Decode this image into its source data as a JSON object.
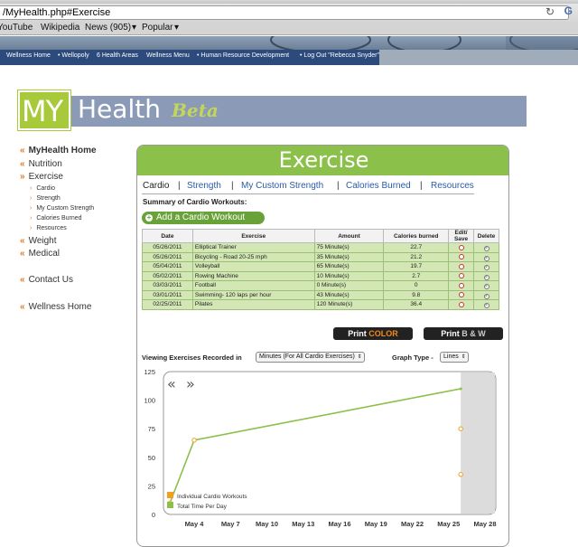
{
  "browser": {
    "url": "/MyHealth.php#Exercise",
    "bookmarks": [
      "YouTube",
      "Wikipedia",
      "News (905)",
      "Popular"
    ]
  },
  "nav": [
    "Wellness Home",
    "Wellopoly",
    "6 Health Areas",
    "Wellness Menu",
    "Human Resource Development",
    "Log Out \"Rebecca Snyder\""
  ],
  "logo": {
    "my": "MY",
    "health": "Health",
    "beta": "Beta"
  },
  "sidebar": {
    "main": [
      {
        "label": "MyHealth Home"
      },
      {
        "label": "Nutrition"
      },
      {
        "label": "Exercise"
      }
    ],
    "exercise_sub": [
      "Cardio",
      "Strength",
      "My Custom Strength",
      "Calories Burned",
      "Resources"
    ],
    "more": [
      {
        "label": "Weight"
      },
      {
        "label": "Medical"
      }
    ],
    "contact": "Contact Us",
    "wellness": "Wellness Home"
  },
  "panel": {
    "title": "Exercise",
    "tabs": [
      "Cardio",
      "Strength",
      "My Custom Strength",
      "Calories Burned",
      "Resources"
    ],
    "summary_title": "Summary of Cardio Workouts:",
    "add_button": "Add a Cardio Workout",
    "table": {
      "headers": [
        "Date",
        "Exercise",
        "Amount",
        "Calories burned",
        "Edit/ Save",
        "Delete"
      ],
      "rows": [
        {
          "date": "05/26/2011",
          "exercise": "Elliptical Trainer",
          "amount": "75 Minute(s)",
          "calories": "22.7"
        },
        {
          "date": "05/26/2011",
          "exercise": "Bicycling - Road 20-25 mph",
          "amount": "35 Minute(s)",
          "calories": "21.2"
        },
        {
          "date": "05/04/2011",
          "exercise": "Volleyball",
          "amount": "65 Minute(s)",
          "calories": "19.7"
        },
        {
          "date": "05/02/2011",
          "exercise": "Rowing Machine",
          "amount": "10 Minute(s)",
          "calories": "2.7"
        },
        {
          "date": "03/03/2011",
          "exercise": "Football",
          "amount": "0 Minute(s)",
          "calories": "0"
        },
        {
          "date": "03/01/2011",
          "exercise": "Swimming- 120 laps per hour",
          "amount": "43 Minute(s)",
          "calories": "9.8"
        },
        {
          "date": "02/25/2011",
          "exercise": "Pilates",
          "amount": "120 Minute(s)",
          "calories": "36.4"
        }
      ]
    },
    "print_color": {
      "prefix": "Print ",
      "accent": "COLOR"
    },
    "print_bw": {
      "prefix": "Print ",
      "accent": "B & W"
    },
    "view_label": "Viewing Exercises Recorded in",
    "view_select": "Minutes (For All Cardio Exercises)",
    "graph_type_label": "Graph Type -",
    "graph_type_select": "Lines"
  },
  "chart_data": {
    "type": "line",
    "nav_prev": "«",
    "nav_next": "»",
    "yticks": [
      0,
      25,
      50,
      75,
      100,
      125
    ],
    "ylim": [
      0,
      125
    ],
    "x_labels": [
      "May 4",
      "May 7",
      "May 10",
      "May 13",
      "May 16",
      "May 19",
      "May 22",
      "May 25",
      "May 28"
    ],
    "x_label_days": [
      4,
      7,
      10,
      13,
      16,
      19,
      22,
      25,
      28
    ],
    "xlim_days": [
      0.4,
      28.3
    ],
    "shaded_from_day": 26,
    "legend": [
      "Individual Cardio Workouts",
      "Total Time Per Day"
    ],
    "colors": {
      "individual": "#f0a020",
      "total": "#8bc04a"
    },
    "total_time_per_day": {
      "days": [
        2,
        4,
        26
      ],
      "values": [
        10,
        65,
        110
      ]
    },
    "individual_workouts": {
      "days": [
        2,
        4,
        26,
        26
      ],
      "values": [
        10,
        65,
        75,
        35
      ]
    }
  }
}
